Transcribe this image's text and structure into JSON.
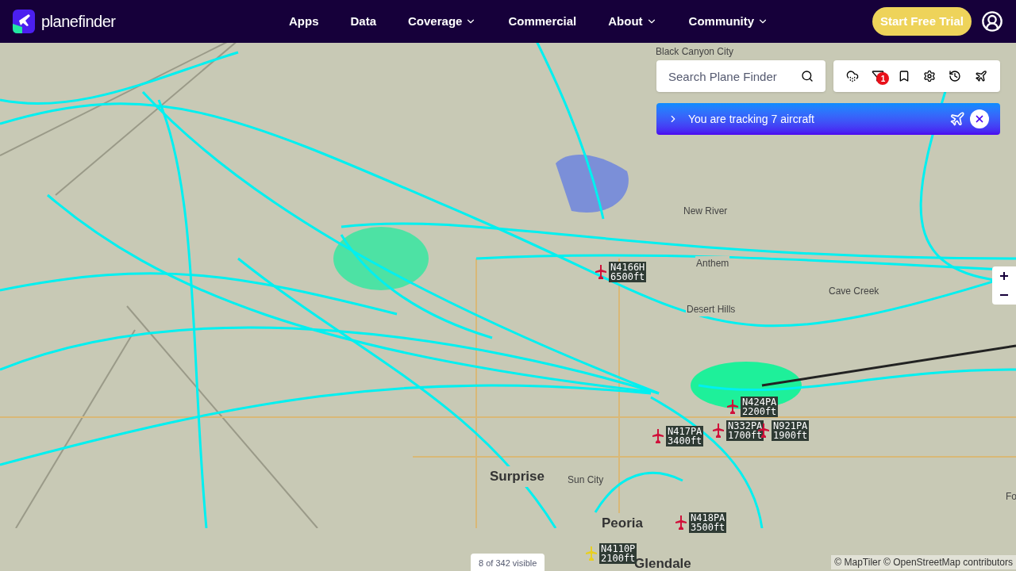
{
  "nav": {
    "logo": "planefinder",
    "items": [
      {
        "label": "Apps",
        "dropdown": false
      },
      {
        "label": "Data",
        "dropdown": false
      },
      {
        "label": "Coverage",
        "dropdown": true
      },
      {
        "label": "Commercial",
        "dropdown": false
      },
      {
        "label": "About",
        "dropdown": true
      },
      {
        "label": "Community",
        "dropdown": true
      }
    ],
    "cta": "Start Free Trial"
  },
  "search": {
    "placeholder": "Search Plane Finder"
  },
  "toolbar": {
    "filter_badge": "1"
  },
  "tracking": {
    "text": "You are tracking 7 aircraft"
  },
  "places": [
    {
      "name": "Black Canyon City",
      "major": false
    },
    {
      "name": "New River",
      "major": false
    },
    {
      "name": "Anthem",
      "major": false
    },
    {
      "name": "Desert Hills",
      "major": false
    },
    {
      "name": "Cave Creek",
      "major": false
    },
    {
      "name": "Surprise",
      "major": true
    },
    {
      "name": "Sun City",
      "major": false
    },
    {
      "name": "Peoria",
      "major": true
    },
    {
      "name": "Glendale",
      "major": true
    },
    {
      "name": "Fo",
      "major": false
    }
  ],
  "aircraft": [
    {
      "callsign": "N4166H",
      "altitude": "6500ft",
      "color": "#d0103a"
    },
    {
      "callsign": "N424PA",
      "altitude": "2200ft",
      "color": "#d0103a"
    },
    {
      "callsign": "N417PA",
      "altitude": "3400ft",
      "color": "#d0103a"
    },
    {
      "callsign": "N332PA",
      "altitude": "1700ft",
      "color": "#d0103a"
    },
    {
      "callsign": "N921PA",
      "altitude": "1900ft",
      "color": "#d0103a"
    },
    {
      "callsign": "N418PA",
      "altitude": "3500ft",
      "color": "#d0103a"
    },
    {
      "callsign": "N4110P",
      "altitude": "2100ft",
      "color": "#e8d020"
    }
  ],
  "visible_count": "8 of 342 visible",
  "attribution": "© MapTiler © OpenStreetMap contributors"
}
